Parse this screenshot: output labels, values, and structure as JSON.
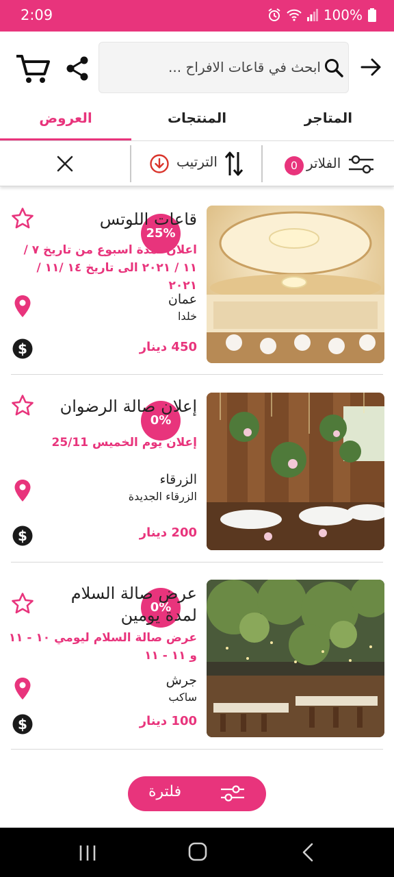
{
  "status_bar": {
    "time": "2:09",
    "battery": "100%"
  },
  "search": {
    "placeholder": "ابحث في قاعات الافراح ..."
  },
  "tabs": [
    {
      "label": "المتاجر",
      "active": false
    },
    {
      "label": "المنتجات",
      "active": false
    },
    {
      "label": "العروض",
      "active": true
    }
  ],
  "filter_bar": {
    "filters_label": "الفلاتر",
    "filters_count": "0",
    "sort_label": "الترتيب"
  },
  "offers": [
    {
      "title": "قاعات اللوتس",
      "promo": "اعلان لمدة اسبوع من تاريخ ٧ / ١١ / ٢٠٢١ الى تاريخ ١٤ /١١ / ٢٠٢١",
      "city": "عمان",
      "area": "خلدا",
      "price": "450 دينار",
      "discount": "25%"
    },
    {
      "title": "إعلان صالة الرضوان",
      "promo": "إعلان يوم الخميس 25/11",
      "city": "الزرقاء",
      "area": "الزرقاء الجديدة",
      "price": "200 دينار",
      "discount": "0%"
    },
    {
      "title": "عرض صالة السلام لمدة يومين",
      "promo": "عرض صالة السلام ليومي ١٠ - ١١ و ١١ - ١١",
      "city": "جرش",
      "area": "ساكب",
      "price": "100 دينار",
      "discount": "0%"
    }
  ],
  "float_button": {
    "label": "فلترة"
  },
  "colors": {
    "accent": "#e8347c",
    "text": "#222222",
    "navbar": "#000000"
  },
  "icons": [
    "cart-icon",
    "share-icon",
    "search-icon",
    "back-arrow-icon",
    "close-icon",
    "sort-icon",
    "filter-sliders-icon",
    "star-icon",
    "location-pin-icon",
    "dollar-icon"
  ]
}
